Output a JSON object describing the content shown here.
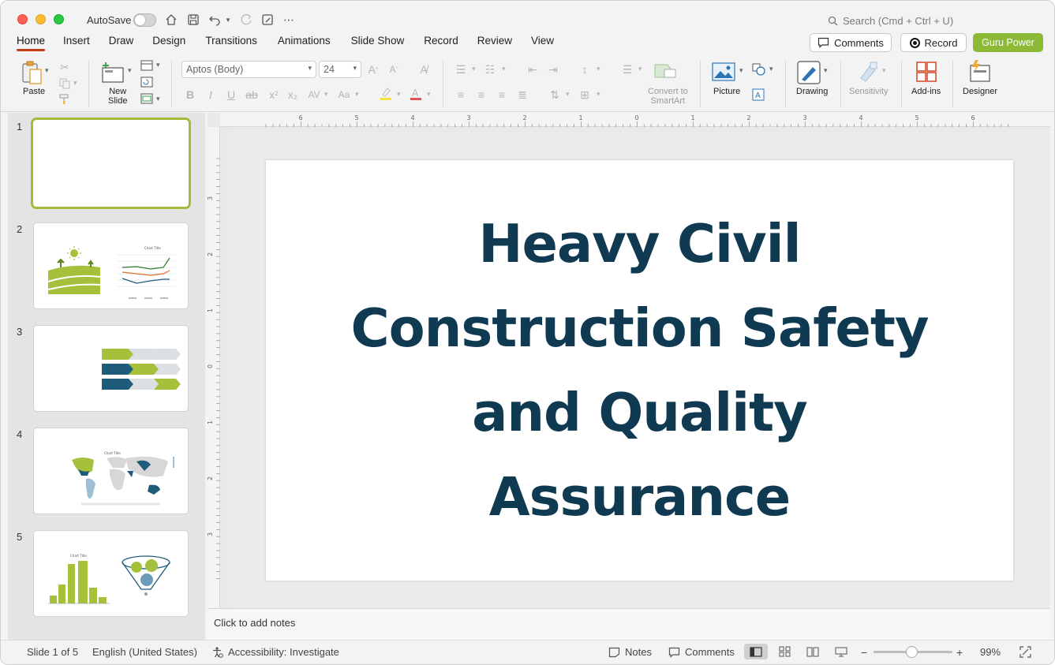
{
  "titlebar": {
    "autosave_label": "AutoSave",
    "search_placeholder": "Search (Cmd + Ctrl + U)"
  },
  "tabs": [
    "Home",
    "Insert",
    "Draw",
    "Design",
    "Transitions",
    "Animations",
    "Slide Show",
    "Record",
    "Review",
    "View"
  ],
  "active_tab": "Home",
  "header_buttons": {
    "comments": "Comments",
    "record": "Record",
    "guru": "Guru Power"
  },
  "ribbon": {
    "paste": "Paste",
    "new_slide_line1": "New",
    "new_slide_line2": "Slide",
    "font_name": "Aptos (Body)",
    "font_size": "24",
    "convert_line1": "Convert to",
    "convert_line2": "SmartArt",
    "picture": "Picture",
    "drawing": "Drawing",
    "sensitivity": "Sensitivity",
    "addins": "Add-ins",
    "designer": "Designer"
  },
  "ruler": {
    "horizontal": [
      "6",
      "5",
      "4",
      "3",
      "2",
      "1",
      "0",
      "1",
      "2",
      "3",
      "4",
      "5",
      "6"
    ],
    "vertical": [
      "3",
      "2",
      "1",
      "0",
      "1",
      "2",
      "3"
    ]
  },
  "thumbnails": [
    {
      "number": "1"
    },
    {
      "number": "2"
    },
    {
      "number": "3"
    },
    {
      "number": "4"
    },
    {
      "number": "5"
    }
  ],
  "slide": {
    "title": "Heavy Civil Construction Safety and Quality Assurance",
    "title_color": "#0f3a52"
  },
  "notes_placeholder": "Click to add notes",
  "statusbar": {
    "slide_info": "Slide 1 of 5",
    "language": "English (United States)",
    "accessibility": "Accessibility: Investigate",
    "notes": "Notes",
    "comments": "Comments",
    "zoom": "99%"
  },
  "colors": {
    "accent": "#c43e1c",
    "guru_green": "#8cb936",
    "thumb_green": "#a5c03b",
    "thumb_blue": "#1f5b7a"
  }
}
